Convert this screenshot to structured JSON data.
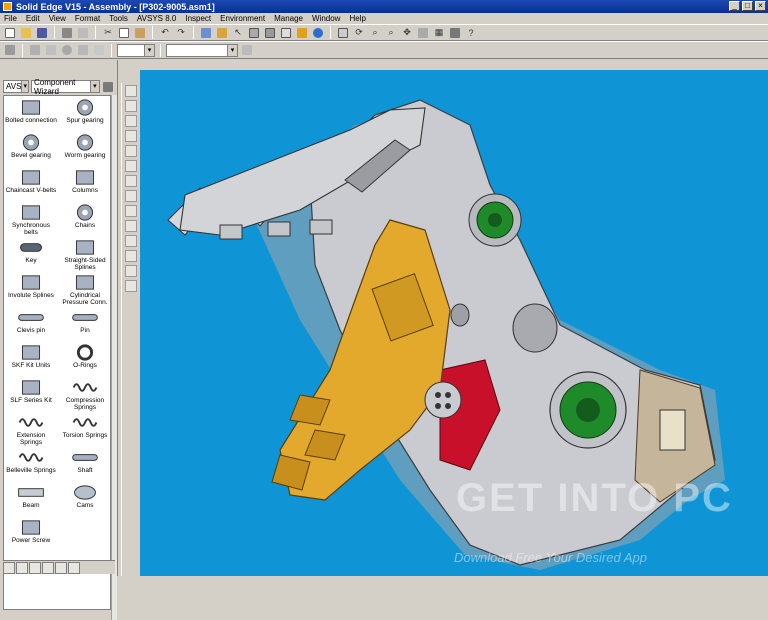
{
  "window": {
    "title": "Solid Edge V15 - Assembly - [P302-9005.asm1]"
  },
  "menu": [
    "File",
    "Edit",
    "View",
    "Format",
    "Tools",
    "AVSYS 8.0",
    "Inspect",
    "Environment",
    "Manage",
    "Window",
    "Help"
  ],
  "library": {
    "filter_value": "AVS",
    "folder_value": "Component Wizard",
    "items": [
      {
        "label": "Bolted connection"
      },
      {
        "label": "Spur gearing"
      },
      {
        "label": "Bevel gearing"
      },
      {
        "label": "Worm gearing"
      },
      {
        "label": "Chaincast V-belts"
      },
      {
        "label": "Columns"
      },
      {
        "label": "Synchronous belts"
      },
      {
        "label": "Chains"
      },
      {
        "label": "Key"
      },
      {
        "label": "Straight-Sided Splines"
      },
      {
        "label": "Involute Splines"
      },
      {
        "label": "Cylindrical Pressure Conn."
      },
      {
        "label": "Clevis pin"
      },
      {
        "label": "Pin"
      },
      {
        "label": "SKF Kit Units"
      },
      {
        "label": "O-Rings"
      },
      {
        "label": "SLF Series Kit"
      },
      {
        "label": "Compression Springs"
      },
      {
        "label": "Extension Springs"
      },
      {
        "label": "Torsion Springs"
      },
      {
        "label": "Belleville Springs"
      },
      {
        "label": "Shaft"
      },
      {
        "label": "Beam"
      },
      {
        "label": "Cams"
      },
      {
        "label": "Power Screw"
      }
    ]
  },
  "watermark": {
    "logo": "GET INTO PC",
    "tagline": "Download Free Your Desired App"
  },
  "colors": {
    "viewport_bg": "#0f95d6",
    "part_grey": "#c9cbd0",
    "jaw_yellow": "#e3a92c",
    "hub_green": "#1e8a2a",
    "titlebar": "#0a2f94"
  }
}
